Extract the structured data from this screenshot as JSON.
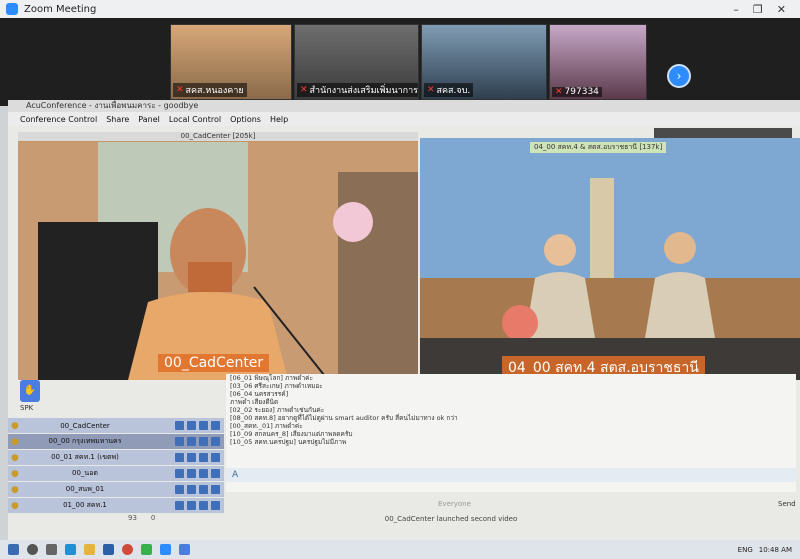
{
  "zoom": {
    "title": "Zoom Meeting",
    "window_controls": [
      "–",
      "❐",
      "✕"
    ],
    "participants": [
      {
        "label": "สคส.หนองคาย"
      },
      {
        "label": "สำนักงานส่งเสริมเพิ่มนาการบัญชี"
      },
      {
        "label": "สคส.จบ."
      },
      {
        "label": "797334"
      }
    ],
    "next_icon": "chevron-right-icon"
  },
  "acu": {
    "title": "AcuConference - งานเพื่อพนมคาระ - goodbye",
    "menu": [
      "Conference Control",
      "Share",
      "Panel",
      "Local Control",
      "Options",
      "Help"
    ],
    "left_video": {
      "title": "00_CadCenter [205k]",
      "name_tag": "00_CadCenter"
    },
    "right_video": {
      "title": "04_00 สคท.4 & สตส.อบราชธานี [137k]",
      "name_tag": "04_00 สคท.4 สตส.อบราชธานี"
    },
    "spk_label": "SPK",
    "participants": [
      {
        "name": "00_CadCenter"
      },
      {
        "name": "00_00 กรุงเทพมหานคร"
      },
      {
        "name": "00_01 สคท.1 (เขตพ)"
      },
      {
        "name": "00_นอต"
      },
      {
        "name": "00_สนพ_01"
      },
      {
        "name": "01_00 สคท.1"
      }
    ],
    "counts": [
      "93",
      "0"
    ],
    "chat": [
      "[06_01 พิษณุโลก] ภาพดำค่ะ",
      "[03_06 ศรีสะเกษ] ภาพดำเหมอะ",
      "[06_04 นครสวรรค์]",
      "ภาพดำ เสียงดีนิด",
      "[02_02 ระยอง] ภาพดำเช่นกันค่ะ",
      "[08_00 สคท.8] อยากดูที่ได้ไม่ดูผ่าน smart auditor ครับ สี่คนไม่มาทาง ok กว่า",
      "[00_สคท._01] ภาพดำค่ะ",
      "[10_09 สกลนคร_8] เสียงมาแต่ภาพลดครับ",
      "[10_05 สคท.นครปฐม] นครปฐมไม่มีภาพ"
    ],
    "chat_input": "A",
    "everyone_label": "Everyone",
    "send_label": "Send",
    "notification": "00_CadCenter launched second video"
  },
  "taskbar": {
    "lang": "ENG",
    "time": "10:48 AM"
  }
}
